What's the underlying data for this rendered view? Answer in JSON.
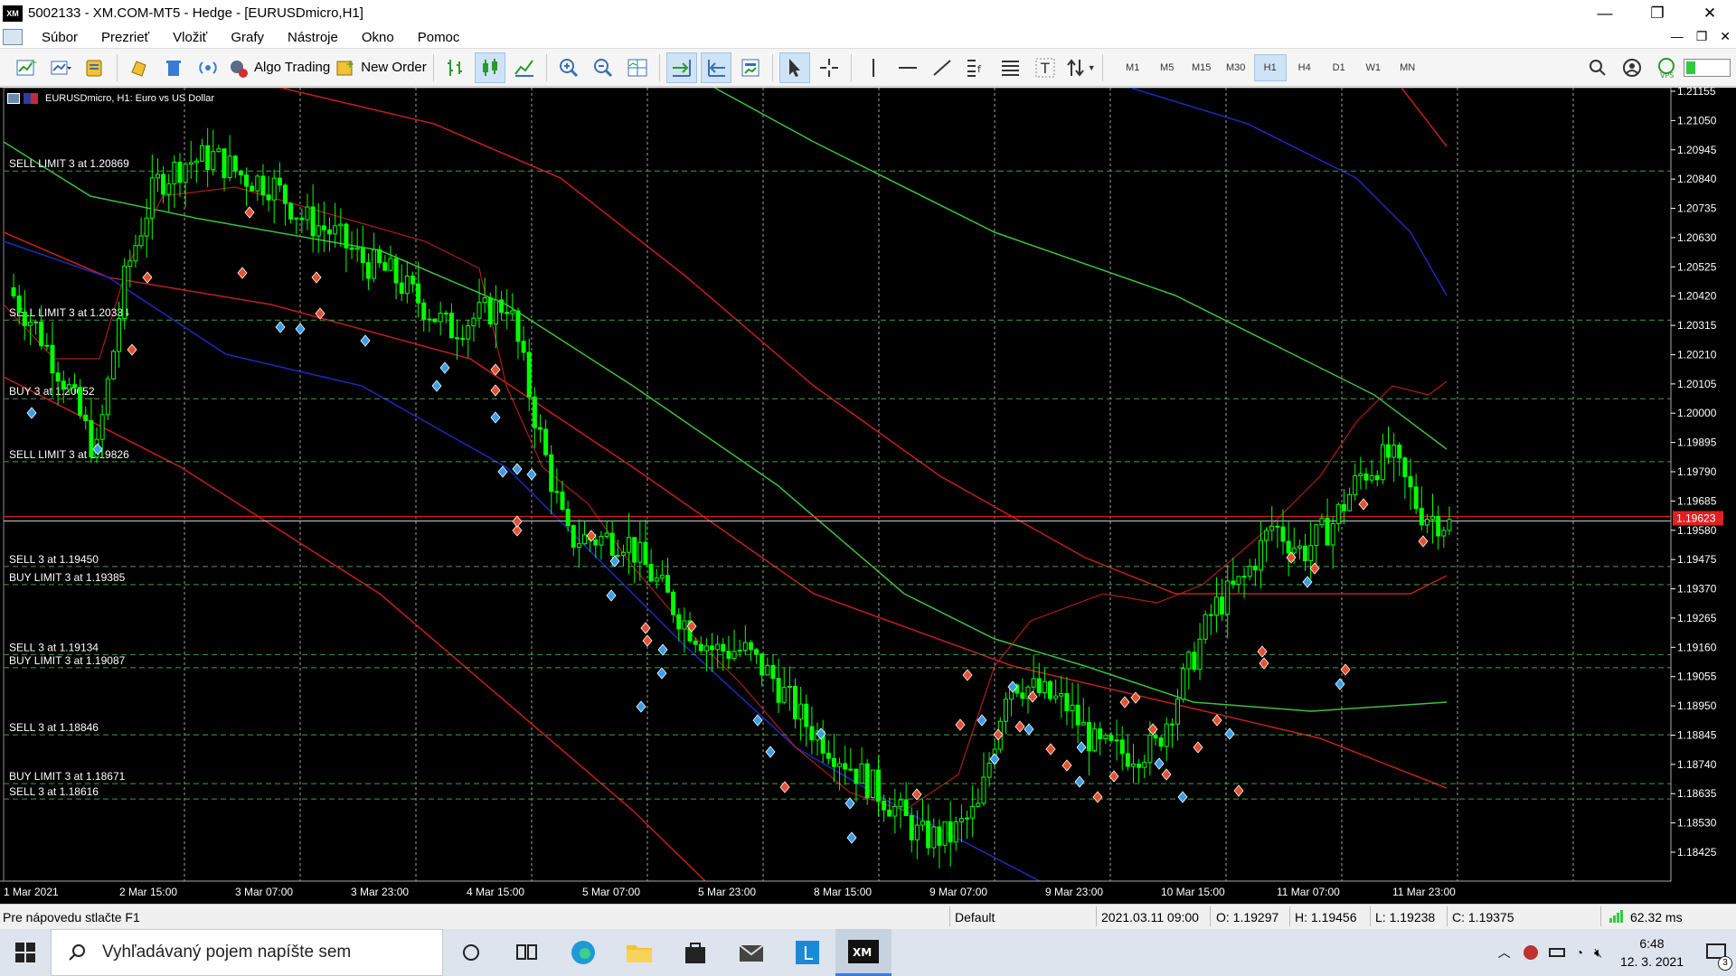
{
  "window": {
    "title": "5002133 - XM.COM-MT5 - Hedge - [EURUSDmicro,H1]",
    "app_icon_label": "XM",
    "controls": [
      "—",
      "❐",
      "✕"
    ]
  },
  "menu": {
    "items": [
      "Súbor",
      "Prezrieť",
      "Vložiť",
      "Grafy",
      "Nástroje",
      "Okno",
      "Pomoc"
    ],
    "mdi_controls": [
      "—",
      "❐",
      "✕"
    ]
  },
  "toolbar": {
    "algo_trading_label": "Algo Trading",
    "new_order_label": "New Order",
    "timeframes": [
      "M1",
      "M5",
      "M15",
      "M30",
      "H1",
      "H4",
      "D1",
      "W1",
      "MN"
    ],
    "active_timeframe": "H1"
  },
  "chart": {
    "header": "EURUSDmicro, H1:  Euro vs US Dollar",
    "current_price": "1.19623",
    "price_ticks": [
      "1.21155",
      "1.21050",
      "1.20945",
      "1.20840",
      "1.20735",
      "1.20630",
      "1.20525",
      "1.20420",
      "1.20315",
      "1.20210",
      "1.20105",
      "1.20000",
      "1.19895",
      "1.19790",
      "1.19685",
      "1.19580",
      "1.19475",
      "1.19370",
      "1.19265",
      "1.19160",
      "1.19055",
      "1.18950",
      "1.18845",
      "1.18740",
      "1.18635",
      "1.18530",
      "1.18425"
    ],
    "time_ticks": [
      "1 Mar 2021",
      "2 Mar 15:00",
      "3 Mar 07:00",
      "3 Mar 23:00",
      "4 Mar 15:00",
      "5 Mar 07:00",
      "5 Mar 23:00",
      "8 Mar 15:00",
      "9 Mar 07:00",
      "9 Mar 23:00",
      "10 Mar 15:00",
      "11 Mar 07:00",
      "11 Mar 23:00"
    ],
    "order_labels": [
      "SELL LIMIT 3 at 1.20869",
      "SELL LIMIT 3 at 1.20334",
      "BUY 3 at 1.20052",
      "SELL LIMIT 3 at 1.19826",
      "SELL 3 at 1.19450",
      "BUY LIMIT 3 at 1.19385",
      "SELL 3 at 1.19134",
      "BUY LIMIT 3 at 1.19087",
      "SELL 3 at 1.18846",
      "BUY LIMIT 3 at 1.18671",
      "SELL 3 at 1.18616"
    ],
    "colors": {
      "background": "#000000",
      "candle": "#00ff00",
      "grid": "#c8c8c8",
      "ma_red": "#c0201c",
      "ma_blue": "#1c2ab8",
      "ma_green": "#3fbf3f",
      "order_line": "#3fa03f",
      "price_line": "#e02020"
    }
  },
  "chart_data": {
    "type": "candlestick",
    "symbol": "EURUSDmicro",
    "timeframe": "H1",
    "ylim": [
      1.1838,
      1.212
    ],
    "x_categories": [
      "1 Mar 2021",
      "2 Mar 15:00",
      "3 Mar 07:00",
      "3 Mar 23:00",
      "4 Mar 15:00",
      "5 Mar 07:00",
      "5 Mar 23:00",
      "8 Mar 15:00",
      "9 Mar 07:00",
      "9 Mar 23:00",
      "10 Mar 15:00",
      "11 Mar 07:00",
      "11 Mar 23:00"
    ],
    "close_path": [
      1.2045,
      1.203,
      1.201,
      1.1985,
      1.205,
      1.2082,
      1.209,
      1.2092,
      1.2085,
      1.2082,
      1.207,
      1.2065,
      1.2055,
      1.205,
      1.204,
      1.203,
      1.2035,
      1.204,
      1.1995,
      1.1955,
      1.1955,
      1.1955,
      1.194,
      1.1925,
      1.1915,
      1.1915,
      1.1905,
      1.189,
      1.188,
      1.187,
      1.186,
      1.1848,
      1.1848,
      1.1858,
      1.1905,
      1.19,
      1.1895,
      1.188,
      1.1878,
      1.188,
      1.1905,
      1.193,
      1.194,
      1.196,
      1.195,
      1.196,
      1.1978,
      1.1985,
      1.1965,
      1.196
    ],
    "current_price": 1.19623,
    "ohlc_status": {
      "time": "2021.03.11 09:00",
      "open": 1.19297,
      "high": 1.19456,
      "low": 1.19238,
      "close": 1.19375
    }
  },
  "status": {
    "help": "Pre nápovedu stlačte F1",
    "profile": "Default",
    "time": "2021.03.11 09:00",
    "open": "O: 1.19297",
    "high": "H: 1.19456",
    "low": "L: 1.19238",
    "close": "C: 1.19375",
    "ping": "62.32 ms"
  },
  "taskbar": {
    "search_placeholder": "Vyhľadávaný pojem napíšte sem",
    "clock_time": "6:48",
    "clock_date": "12. 3. 2021",
    "notification_count": "3"
  }
}
